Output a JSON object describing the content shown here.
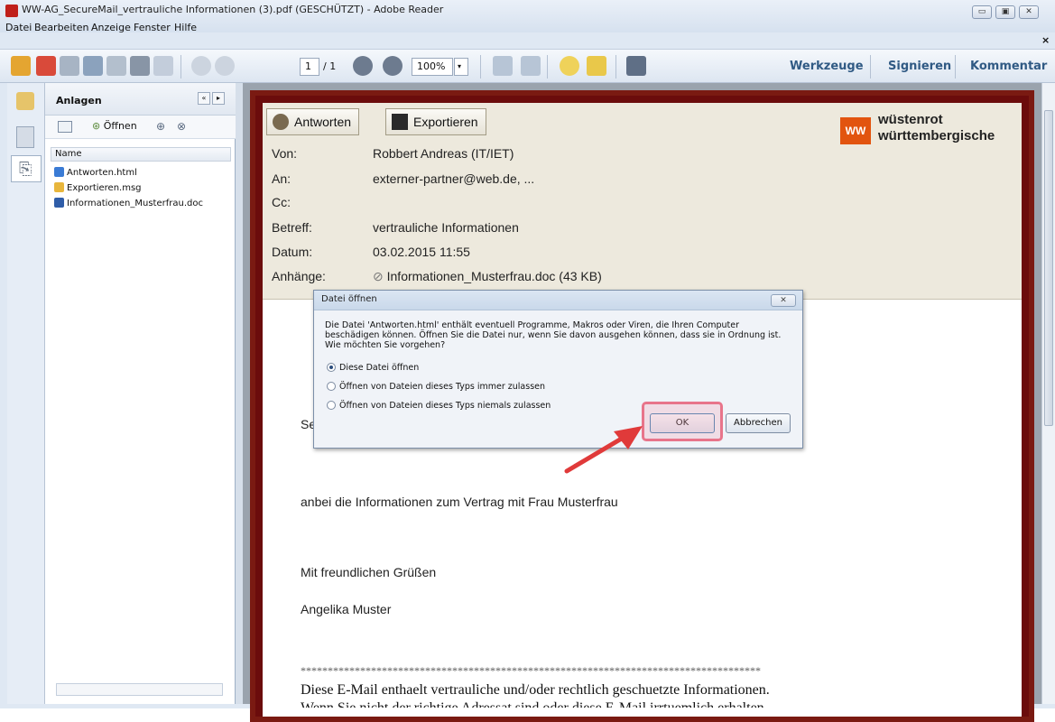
{
  "window": {
    "title": "WW-AG_SecureMail_vertrauliche Informationen (3).pdf (GESCHÜTZT) - Adobe Reader",
    "close_glyph": "×"
  },
  "menu": [
    "Datei",
    "Bearbeiten",
    "Anzeige",
    "Fenster",
    "Hilfe"
  ],
  "toolbar": {
    "page_current": "1",
    "page_total": "/ 1",
    "zoom": "100%",
    "links": [
      "Werkzeuge",
      "Signieren",
      "Kommentar"
    ]
  },
  "panel": {
    "title": "Anlagen",
    "open_label": "Öffnen",
    "column_name": "Name",
    "files": [
      "Antworten.html",
      "Exportieren.msg",
      "Informationen_Musterfrau.doc"
    ]
  },
  "mail": {
    "reply_label": "Antworten",
    "export_label": "Exportieren",
    "logo": {
      "mark": "WW",
      "line1": "wüstenrot",
      "line2": "württembergische"
    },
    "fields": {
      "from_label": "Von:",
      "from": "Robbert Andreas (IT/IET)",
      "to_label": "An:",
      "to": "externer-partner@web.de, ...",
      "cc_label": "Cc:",
      "subject_label": "Betreff:",
      "subject": "vertrauliche Informationen",
      "date_label": "Datum:",
      "date": "03.02.2015 11:55",
      "attach_label": "Anhänge:",
      "attachment": "Informationen_Musterfrau.doc (43 KB)"
    },
    "body": {
      "greeting_partial": "Se",
      "line1": "anbei die Informationen zum Vertrag mit Frau Musterfrau",
      "closing": "Mit freundlichen Grüßen",
      "signature": "Angelika Muster",
      "stars": "*************************************************************************************",
      "disclaimer": "Diese E-Mail enthaelt vertrauliche und/oder rechtlich geschuetzte Informationen.",
      "disclaimer2": "Wenn Sie nicht der richtige Adressat sind oder diese E-Mail irrtuemlich erhalten"
    }
  },
  "dialog": {
    "title": "Datei öffnen",
    "message": "Die Datei 'Antworten.html' enthält eventuell Programme, Makros oder Viren, die Ihren Computer beschädigen können. Öffnen Sie die Datei nur, wenn Sie davon ausgehen können, dass sie in Ordnung ist. Wie möchten Sie vorgehen?",
    "options": [
      "Diese Datei öffnen",
      "Öffnen von Dateien dieses Typs immer zulassen",
      "Öffnen von Dateien dieses Typs niemals zulassen"
    ],
    "selected_option": "Diese Datei öffnen",
    "ok_label": "OK",
    "cancel_label": "Abbrechen"
  },
  "colors": {
    "highlight": "#e8748a",
    "arrow": "#e03a3a",
    "logo": "#e2540f",
    "page_border": "#6b0c0c"
  }
}
